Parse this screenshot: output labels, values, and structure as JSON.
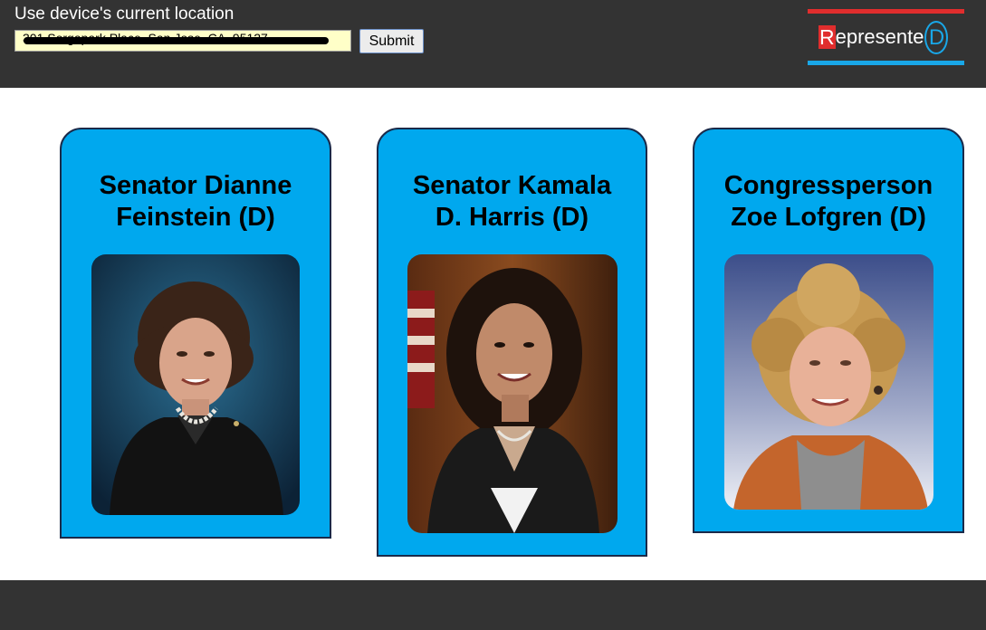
{
  "header": {
    "location_label": "Use device's current location",
    "address_value": "301 Sorgapark Place, San Jose, CA, 95127",
    "submit_label": "Submit"
  },
  "logo": {
    "r": "R",
    "middle": "epresente",
    "d": "D"
  },
  "cards": [
    {
      "title": "Senator Dianne Feinstein (D)",
      "photo": "dianne-feinstein-portrait"
    },
    {
      "title": "Senator Kamala D. Harris (D)",
      "photo": "kamala-harris-portrait"
    },
    {
      "title": "Congressperson Zoe Lofgren (D)",
      "photo": "zoe-lofgren-portrait"
    }
  ],
  "colors": {
    "header_bg": "#333333",
    "card_bg": "#00a8ee",
    "card_border": "#1a2a4a",
    "logo_red": "#e02d2d",
    "logo_blue": "#19a7e8",
    "input_bg": "#ffffc8"
  }
}
